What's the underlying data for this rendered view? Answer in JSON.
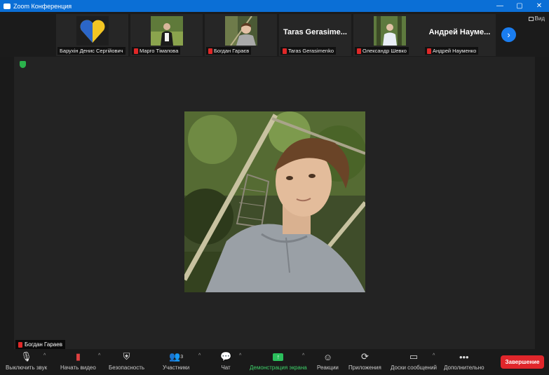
{
  "window": {
    "title": "Zoom Конференция",
    "controls": [
      "—",
      "▢",
      "✕"
    ]
  },
  "view_label": "Вид",
  "participants_strip": [
    {
      "name": "Барухін Денис Сергійович",
      "muted": false,
      "kind": "avatar-heart"
    },
    {
      "name": "Марго Тімапова",
      "muted": true,
      "kind": "photo-woman"
    },
    {
      "name": "Богдан Гараєв",
      "muted": true,
      "kind": "photo-man"
    },
    {
      "name": "Taras Gerasimenko",
      "display_name": "Taras Gerasime...",
      "muted": true,
      "kind": "text"
    },
    {
      "name": "Олександр Шевко",
      "muted": true,
      "kind": "photo-man2"
    },
    {
      "name": "Андрей Науменко",
      "display_name": "Андрей Науме...",
      "muted": true,
      "kind": "text"
    }
  ],
  "active_speaker": {
    "name": "Богдан Гараев",
    "muted": true
  },
  "toolbar": {
    "mute_label": "Выключить звук",
    "video_label": "Начать видео",
    "security_label": "Безопасность",
    "participants_label": "Участники",
    "participants_count": "3",
    "chat_label": "Чат",
    "share_label": "Демонстрация экрана",
    "reactions_label": "Реакции",
    "apps_label": "Приложения",
    "whiteboard_label": "Доски сообщений",
    "more_label": "Дополнительно",
    "end_label": "Завершение"
  }
}
